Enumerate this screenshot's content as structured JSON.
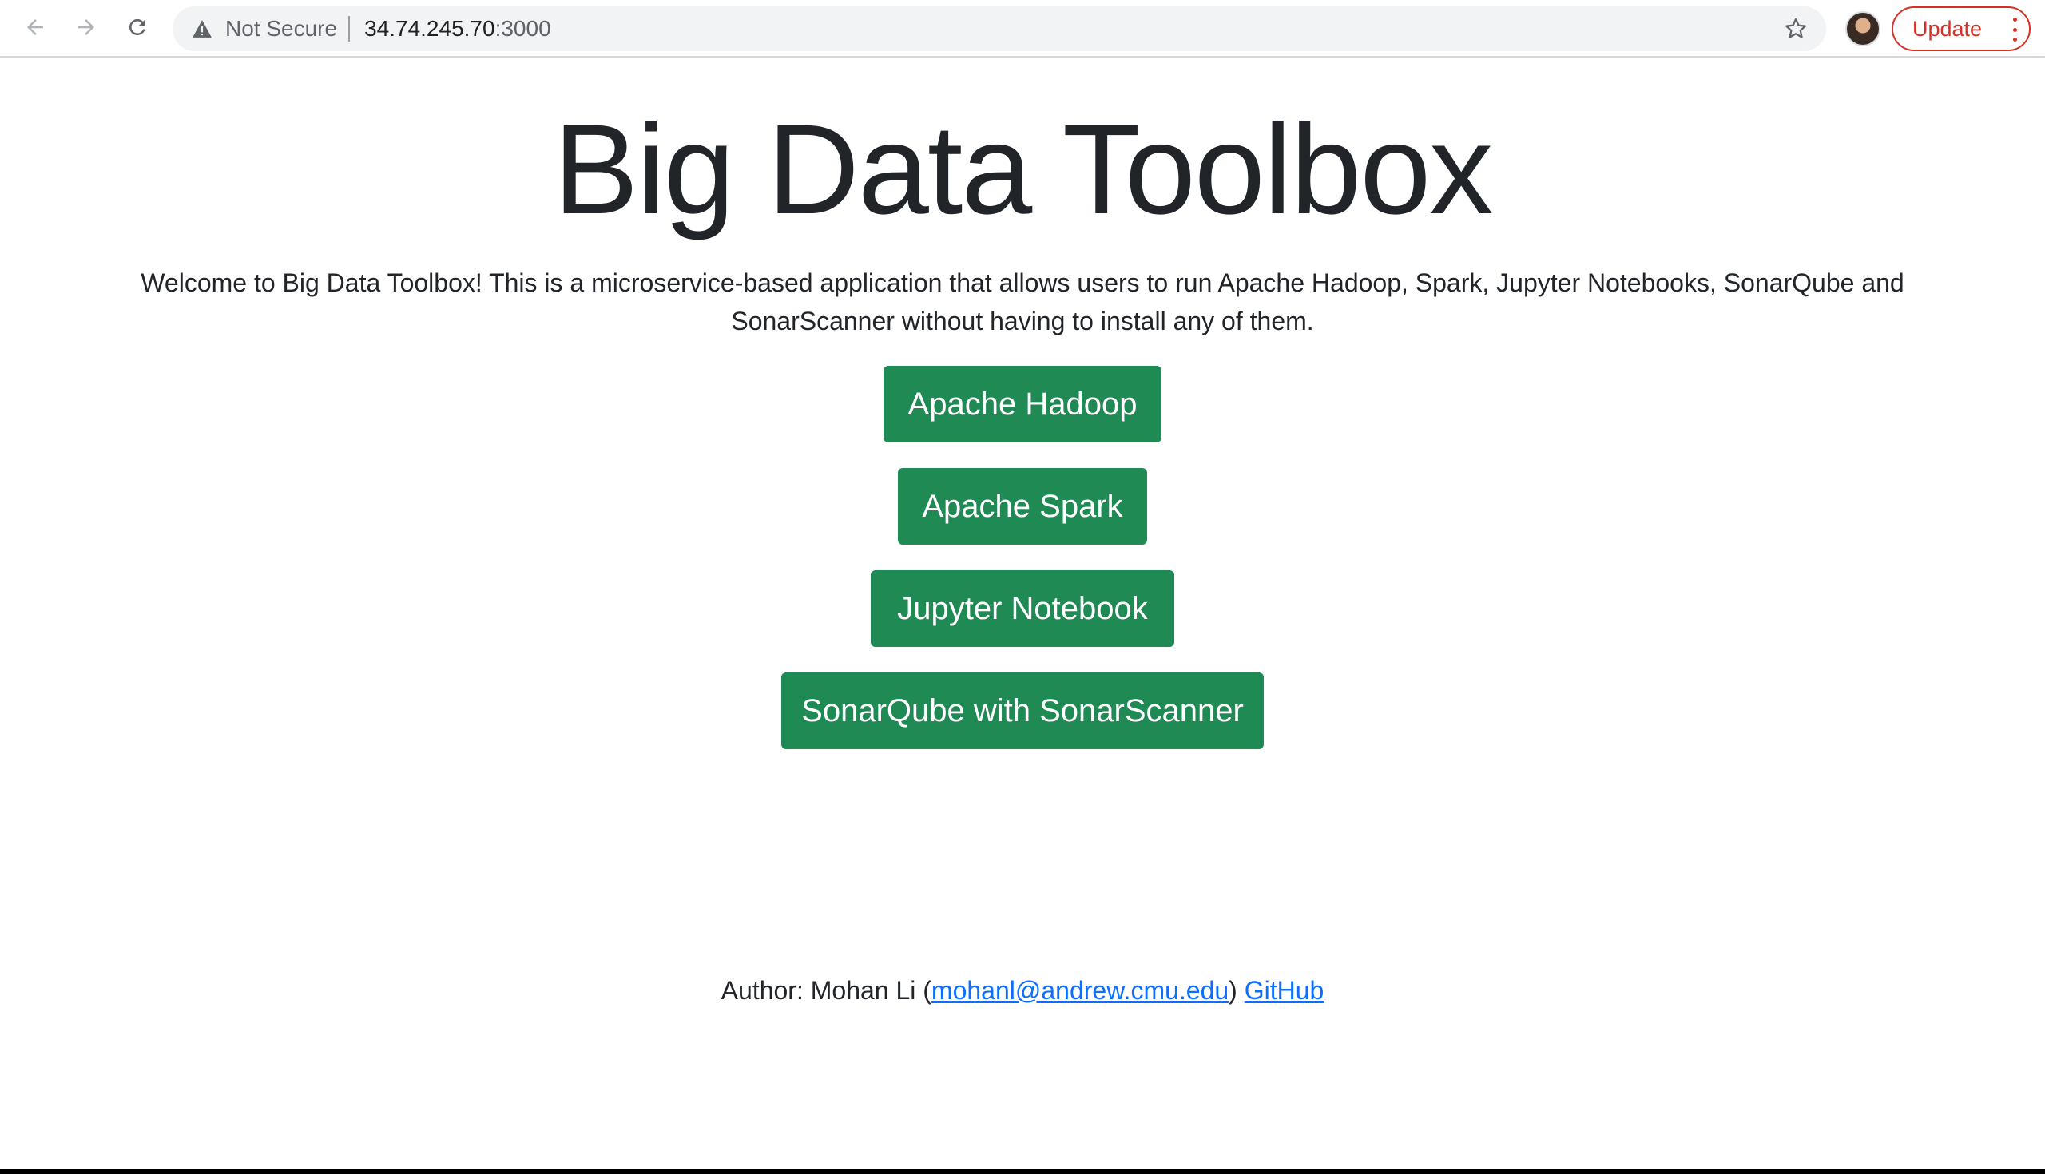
{
  "browser": {
    "security_label": "Not Secure",
    "url_host": "34.74.245.70",
    "url_port": ":3000",
    "update_label": "Update",
    "icons": {
      "back": "arrow-left-icon",
      "forward": "arrow-right-icon",
      "reload": "reload-icon",
      "security": "warning-icon",
      "bookmark": "star-icon",
      "menu": "kebab-icon"
    },
    "colors": {
      "update_accent": "#d93025",
      "omnibox_bg": "#f1f3f4"
    }
  },
  "page": {
    "title": "Big Data Toolbox",
    "intro": "Welcome to Big Data Toolbox! This is a microservice-based application that allows users to run Apache Hadoop, Spark, Jupyter Notebooks, SonarQube and SonarScanner without having to install any of them.",
    "buttons": [
      {
        "label": "Apache Hadoop"
      },
      {
        "label": "Apache Spark"
      },
      {
        "label": "Jupyter Notebook"
      },
      {
        "label": "SonarQube with SonarScanner"
      }
    ],
    "button_color": "#208a55",
    "footer": {
      "prefix": "Author: Mohan Li (",
      "email": "mohanl@andrew.cmu.edu",
      "suffix": ") ",
      "github": "GitHub"
    },
    "link_color": "#0d6efd"
  }
}
